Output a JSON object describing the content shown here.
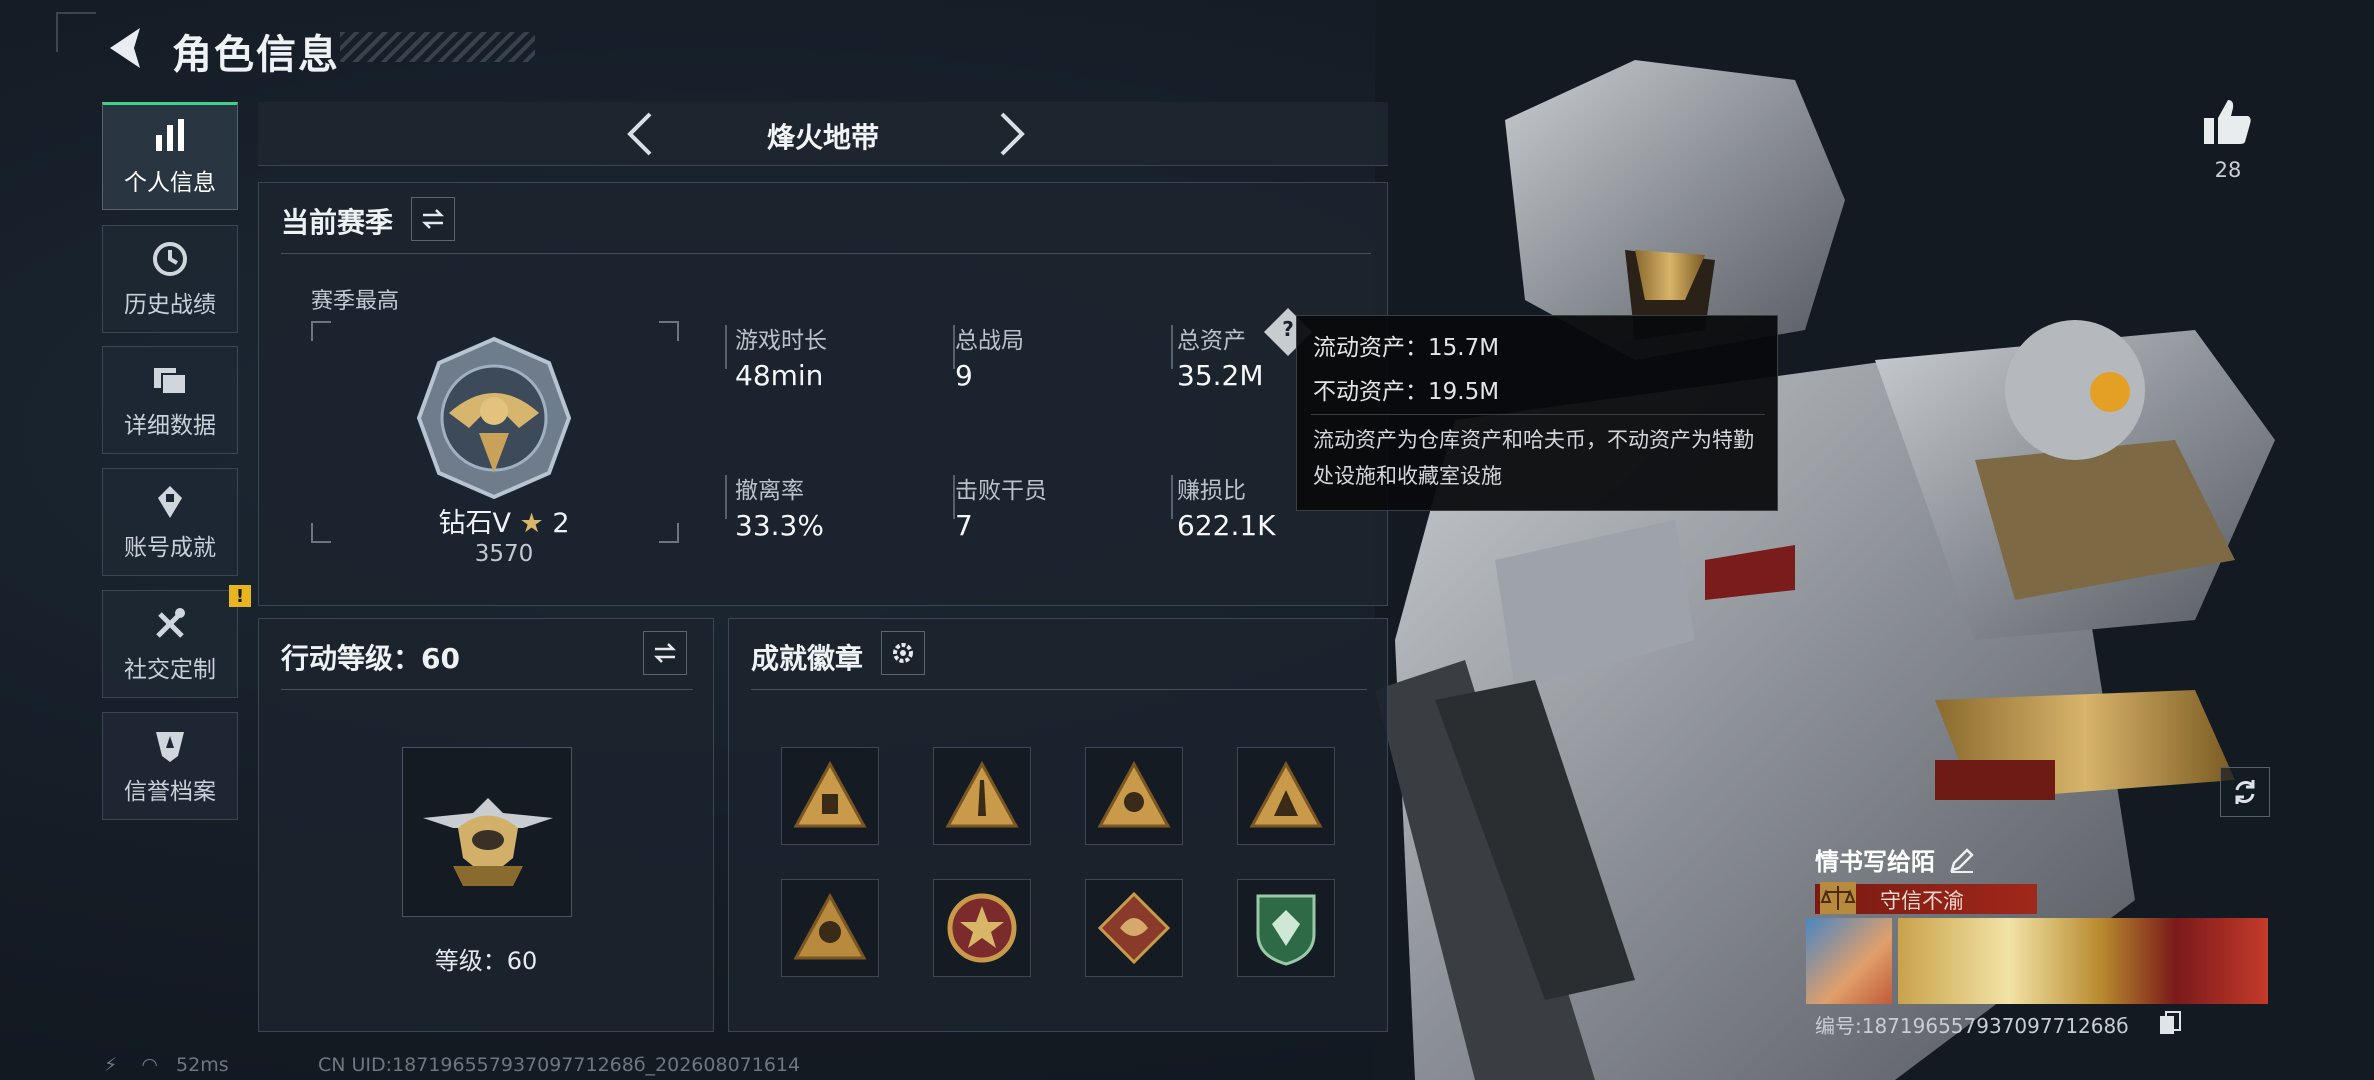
{
  "header": {
    "title": "角色信息"
  },
  "sidebar": {
    "items": [
      {
        "label": "个人信息",
        "icon": "bar-chart-icon"
      },
      {
        "label": "历史战绩",
        "icon": "history-clock-icon"
      },
      {
        "label": "详细数据",
        "icon": "folder-icon"
      },
      {
        "label": "账号成就",
        "icon": "achievement-icon"
      },
      {
        "label": "社交定制",
        "icon": "tools-icon",
        "badge": "!"
      },
      {
        "label": "信誉档案",
        "icon": "shield-icon"
      }
    ]
  },
  "mode": {
    "name": "烽火地带"
  },
  "season": {
    "title": "当前赛季",
    "best_label": "赛季最高",
    "rank_name": "钻石V",
    "rank_stars": "2",
    "rank_score": "3570",
    "stats": [
      {
        "label": "游戏时长",
        "value": "48min"
      },
      {
        "label": "总战局",
        "value": "9"
      },
      {
        "label": "总资产",
        "value": "35.2M"
      },
      {
        "label": "撤离率",
        "value": "33.3%"
      },
      {
        "label": "击败干员",
        "value": "7"
      },
      {
        "label": "赚损比",
        "value": "622.1K"
      }
    ]
  },
  "tooltip": {
    "liquid": "流动资产：15.7M",
    "fixed": "不动资产：19.5M",
    "note": "流动资产为仓库资产和哈夫币，不动资产为特勤处设施和收藏室设施"
  },
  "action_level": {
    "title": "行动等级：60",
    "level_text": "等级：60"
  },
  "achievements": {
    "title": "成就徽章",
    "badges": [
      "badge-1",
      "badge-2",
      "badge-3",
      "badge-4",
      "badge-5",
      "badge-6",
      "badge-7",
      "badge-8"
    ]
  },
  "profile": {
    "likes": "28",
    "player_name": "情书写给陌",
    "title_badge": "守信不渝",
    "uid_label": "编号:18719655793709771268б"
  },
  "footer": {
    "ping": "52ms",
    "uid": "CN UID:18719655793709771268б_202608071614"
  },
  "colors": {
    "accent": "#3fd08a",
    "warn": "#e8b521",
    "gold": "#c9a25a"
  }
}
